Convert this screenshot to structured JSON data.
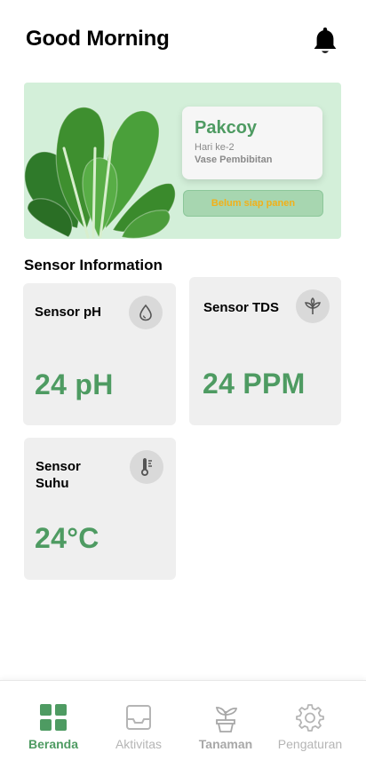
{
  "header": {
    "greeting": "Good Morning",
    "notification_icon": "bell-icon"
  },
  "plant": {
    "name": "Pakcoy",
    "day": "Hari ke-2",
    "location": "Vase Pembibitan",
    "status_button": "Belum siap panen",
    "status_color": "#f2b019"
  },
  "sensors": {
    "title": "Sensor Information",
    "ph": {
      "label": "Sensor pH",
      "value": "24 pH",
      "icon": "water-drop-icon"
    },
    "tds": {
      "label": "Sensor TDS",
      "value": "24 PPM",
      "icon": "sprout-icon"
    },
    "temp": {
      "label_line1": "Sensor",
      "label_line2": "Suhu",
      "value": "24°C",
      "icon": "thermometer-icon"
    }
  },
  "nav": {
    "items": [
      {
        "label": "Beranda",
        "icon": "grid-icon",
        "active": true
      },
      {
        "label": "Aktivitas",
        "icon": "inbox-icon",
        "active": false
      },
      {
        "label": "Tanaman",
        "icon": "potted-plant-icon",
        "active": false
      },
      {
        "label": "Pengaturan",
        "icon": "gear-icon",
        "active": false
      }
    ]
  },
  "colors": {
    "accent_green": "#4e9b62",
    "card_bg": "#efefef",
    "banner_bg": "#d3efd9"
  }
}
